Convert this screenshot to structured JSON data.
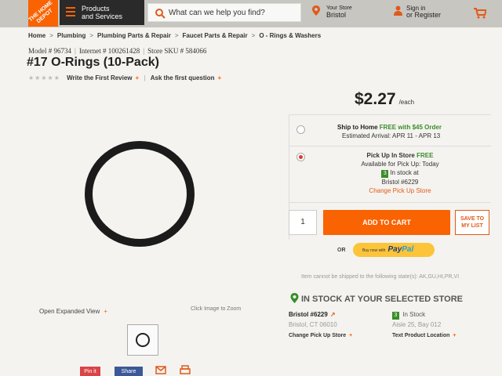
{
  "header": {
    "logo_text": "THE HOME DEPOT",
    "products_label_1": "Products",
    "products_label_2": "and Services",
    "search_placeholder": "What can we help you find?",
    "store_label": "Your Store",
    "store_name": "Bristol",
    "signin_1": "Sign in",
    "signin_2": "or Register",
    "accent_color": "#f96302"
  },
  "breadcrumb": [
    "Home",
    "Plumbing",
    "Plumbing Parts & Repair",
    "Faucet Parts & Repair",
    "O - Rings & Washers"
  ],
  "product": {
    "model": "Model # 96734",
    "internet": "Internet # 100261428",
    "store_sku": "Store SKU # 584066",
    "title": "#17 O-Rings (10-Pack)",
    "stars": "★★★★★",
    "write_review": "Write the First Review",
    "ask_question": "Ask the first question",
    "expand_label": "Open Expanded View",
    "zoom_hint": "Click Image to Zoom",
    "share_pin": "Pin it",
    "share_fb": "Share"
  },
  "purchase": {
    "price": "$2.27",
    "unit": "/each",
    "ship_title": "Ship to Home",
    "ship_free": "FREE with $45 Order",
    "ship_arrival": "Estimated Arrival: APR 11 - APR 13",
    "pickup_title": "Pick Up In Store",
    "pickup_free": "FREE",
    "pickup_avail": "Available for Pick Up: Today",
    "stock_count": "3",
    "stock_at": "In stock at",
    "stock_store": "Bristol #6229",
    "change_store": "Change Pick Up Store",
    "qty": "1",
    "add_to_cart": "ADD TO CART",
    "save_list": "SAVE TO MY LIST",
    "or": "OR",
    "paypal_prefix": "Buy now with",
    "paypal_pay": "Pay",
    "paypal_pal": "Pal"
  },
  "store_info": {
    "no_ship": "Item cannot be shipped to the following state(s): AK,GU,HI,PR,VI",
    "in_stock_heading": "IN STOCK AT YOUR SELECTED STORE",
    "store_name": "Bristol #6229",
    "store_city": "Bristol, CT 06010",
    "change_store": "Change Pick Up Store",
    "stock_count": "3",
    "stock_label": "In Stock",
    "aisle": "Aisle 25, Bay 012",
    "text_location": "Text Product Location"
  }
}
